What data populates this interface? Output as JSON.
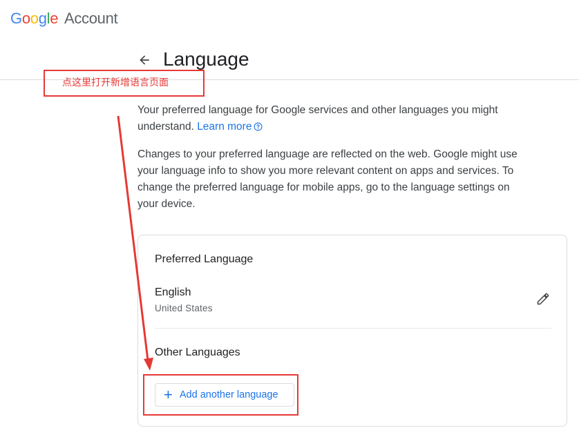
{
  "header": {
    "logo_letters": [
      "G",
      "o",
      "o",
      "g",
      "l",
      "e"
    ],
    "account_label": "Account"
  },
  "page": {
    "title": "Language",
    "description_1": "Your preferred language for Google services and other languages you might understand.",
    "learn_more": "Learn more",
    "description_2": "Changes to your preferred language are reflected on the web. Google might use your language info to show you more relevant content on apps and services. To change the preferred language for mobile apps, go to the language settings on your device."
  },
  "card": {
    "preferred_title": "Preferred Language",
    "preferred_language": "English",
    "preferred_region": "United States",
    "other_title": "Other Languages",
    "add_button_label": "Add another language"
  },
  "annotation": {
    "note": "点这里打开新增语言页面",
    "color": "#e53935"
  },
  "icons": {
    "back": "arrow-back-icon",
    "help": "help-circle-icon",
    "edit": "pencil-icon",
    "add": "plus-icon"
  },
  "colors": {
    "link": "#1a73e8",
    "text_primary": "#202124",
    "text_secondary": "#5f6368",
    "border": "#dadce0"
  }
}
